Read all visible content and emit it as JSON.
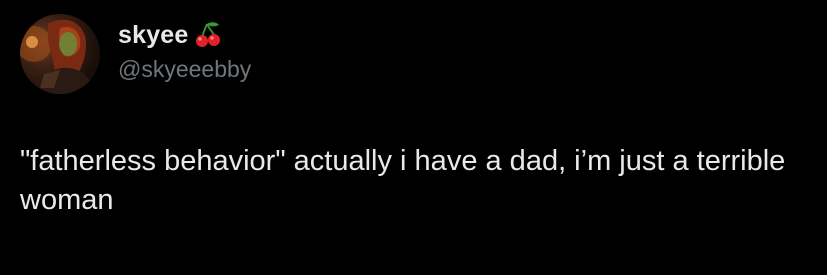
{
  "author": {
    "display_name": "skyee",
    "badge_icon": "cherry-icon",
    "handle": "@skyeeebby",
    "avatar_icon": "profile-avatar"
  },
  "tweet": {
    "text": "\"fatherless behavior\" actually i have a dad, i’m just a terrible woman"
  },
  "colors": {
    "background": "#000000",
    "primary_text": "#e7e9ea",
    "secondary_text": "#71767b",
    "cherry_red": "#e0202a",
    "leaf_green": "#3a9a2e"
  }
}
